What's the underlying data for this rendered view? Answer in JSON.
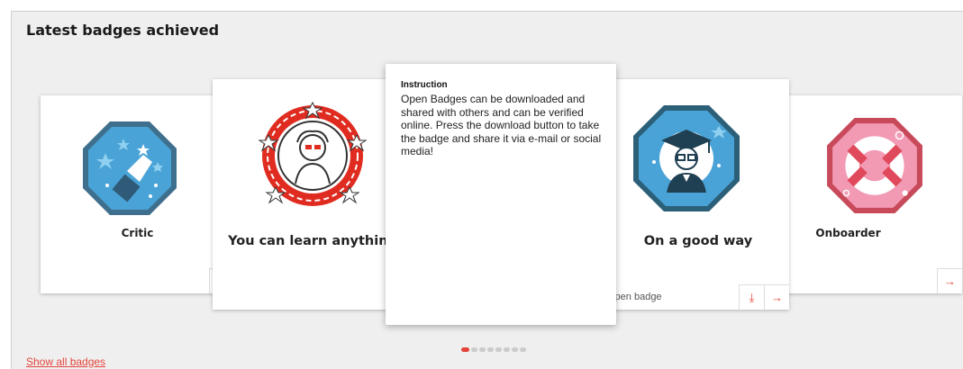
{
  "panel": {
    "title": "Latest badges achieved"
  },
  "badges": [
    {
      "name": "Critic",
      "icon": "critic-badge-icon"
    },
    {
      "name": "You can learn anything",
      "icon": "learn-badge-icon"
    },
    {
      "name": "On a good way",
      "icon": "graduate-badge-icon"
    },
    {
      "name": "Onboarder",
      "icon": "lifebuoy-badge-icon"
    }
  ],
  "card_actions": {
    "open_badge_label": "Open badge",
    "download_icon": "download-icon",
    "next_icon": "arrow-right-icon"
  },
  "instruction": {
    "heading": "Instruction",
    "text": "Open Badges can be downloaded and shared with others and can be verified online. Press the download button to take the badge and share it via e-mail or social media!"
  },
  "carousel": {
    "page_count": 8,
    "active_page": 1
  },
  "footer": {
    "show_all_label": "Show all badges"
  },
  "colors": {
    "accent": "#e4443a",
    "background": "#efefef",
    "badge_blue": "#4aa3d6",
    "badge_pink": "#f29ab4"
  }
}
